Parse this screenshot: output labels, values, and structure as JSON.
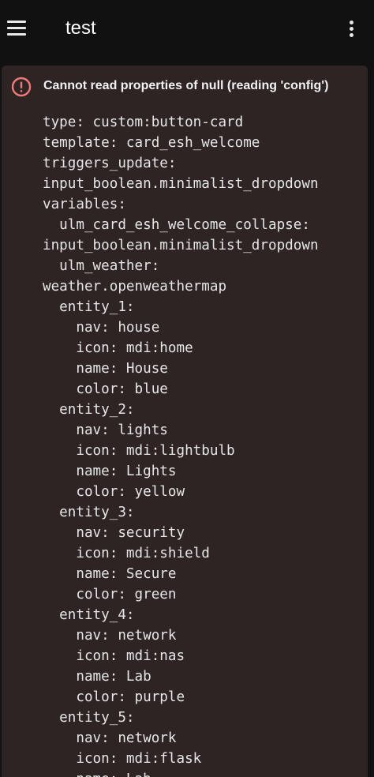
{
  "header": {
    "title": "test",
    "menu_icon": "hamburger-menu-icon",
    "more_icon": "vertical-dots-icon"
  },
  "error": {
    "icon": "alert-circle-icon",
    "message": "Cannot read properties of null (reading 'config')",
    "icon_color": "#f07a7a"
  },
  "config_lines": [
    "type: custom:button-card",
    "template: card_esh_welcome",
    "triggers_update:",
    "input_boolean.minimalist_dropdown",
    "variables:",
    "  ulm_card_esh_welcome_collapse:",
    "input_boolean.minimalist_dropdown",
    "  ulm_weather:",
    "weather.openweathermap",
    "  entity_1:",
    "    nav: house",
    "    icon: mdi:home",
    "    name: House",
    "    color: blue",
    "  entity_2:",
    "    nav: lights",
    "    icon: mdi:lightbulb",
    "    name: Lights",
    "    color: yellow",
    "  entity_3:",
    "    nav: security",
    "    icon: mdi:shield",
    "    name: Secure",
    "    color: green",
    "  entity_4:",
    "    nav: network",
    "    icon: mdi:nas",
    "    name: Lab",
    "    color: purple",
    "  entity_5:",
    "    nav: network",
    "    icon: mdi:flask",
    "    name: Lab"
  ]
}
